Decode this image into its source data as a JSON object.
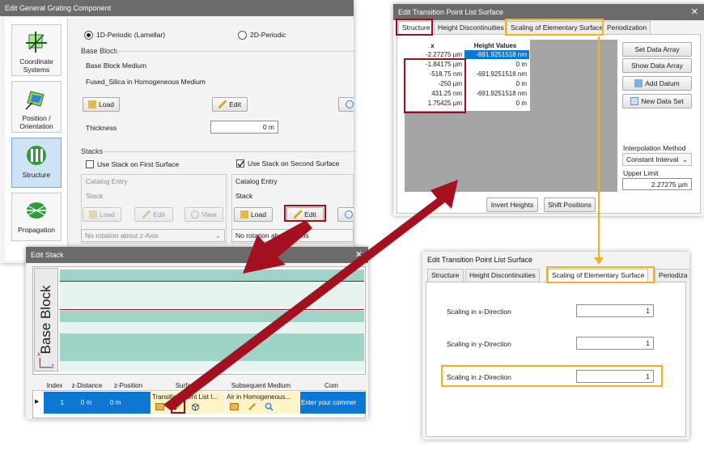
{
  "grating": {
    "title": "Edit General Grating Component",
    "sidebar": [
      "Coordinate Systems",
      "Position / Orientation",
      "Structure",
      "Propagation"
    ],
    "periodic_1d": "1D-Periodic (Lamellar)",
    "periodic_2d": "2D-Periodic",
    "base_block_group": "Base Block",
    "base_block_medium_label": "Base Block Medium",
    "medium_value": "Fused_Silica in Homogeneous Medium",
    "load": "Load",
    "edit": "Edit",
    "view": "View",
    "thickness_label": "Thickness",
    "thickness_value": "0 m",
    "stacks_group": "Stacks",
    "use_first": "Use Stack on First Surface",
    "use_second": "Use Stack on Second Surface",
    "catalog_entry": "Catalog Entry",
    "stack": "Stack",
    "rotation_first": "No rotation about z-Axis",
    "rotation_second": "No rotation about z-Axis"
  },
  "stack": {
    "title": "Edit Stack",
    "base_block": "Base Block",
    "axis_x": "x",
    "axis_z": "z",
    "columns": [
      "Index",
      "z-Distance",
      "z-Position",
      "Surface",
      "Subsequent Medium",
      "Com"
    ],
    "row": {
      "index": "1",
      "z_distance": "0 m",
      "z_position": "0 m",
      "surface": "Transition Point List I...",
      "medium": "Air in Homogeneous...",
      "comment": "Enter your commer"
    }
  },
  "tpl": {
    "title": "Edit Transition Point List Surface",
    "tabs": [
      "Structure",
      "Height Discontinuities",
      "Scaling of Elementary Surface",
      "Periodization"
    ],
    "col_x": "x",
    "col_h": "Height Values",
    "rows": [
      {
        "x": "-2.27275 µm",
        "h": "-691.9251518 nm"
      },
      {
        "x": "-1.84175 µm",
        "h": "0 m"
      },
      {
        "x": "-518.75 nm",
        "h": "-691.9251518 nm"
      },
      {
        "x": "-250 µm",
        "h": "0 m"
      },
      {
        "x": "431.25 nm",
        "h": "-691.9251518 nm"
      },
      {
        "x": "1.75425 µm",
        "h": "0 m"
      }
    ],
    "set_data_array": "Set Data Array",
    "show_data_array": "Show Data Array",
    "add_datum": "Add Datum",
    "new_data_set": "New Data Set",
    "interp_label": "Interpolation Method",
    "interp_value": "Constant Interval",
    "upper_limit_label": "Upper Limit",
    "upper_limit_value": "2.27275 µm",
    "invert_heights": "Invert Heights",
    "shift_positions": "Shift Positions"
  },
  "scaling": {
    "title": "Edit Transition Point List Surface",
    "tabs": [
      "Structure",
      "Height Discontinuities",
      "Scaling of Elementary Surface",
      "Periodiza"
    ],
    "x_label": "Scaling in x-Direction",
    "x_value": "1",
    "y_label": "Scaling in y-Direction",
    "y_value": "1",
    "z_label": "Scaling in z-Direction",
    "z_value": "1"
  },
  "colors": {
    "highlight_red": "#9b1020",
    "highlight_gold": "#f2b21a",
    "arrow_red": "#a3101f",
    "selection_blue": "#0d78d4",
    "layer_teal": "#9fd3c7"
  }
}
